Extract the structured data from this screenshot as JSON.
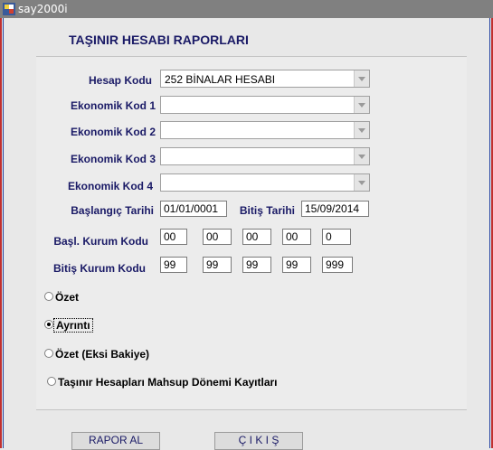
{
  "window": {
    "title": "say2000i"
  },
  "form": {
    "heading": "TAŞINIR HESABI RAPORLARI",
    "hesap_kodu": {
      "label": "Hesap Kodu",
      "value": "252 BİNALAR HESABI"
    },
    "ekonomik_kod_1": {
      "label": "Ekonomik Kod 1",
      "value": ""
    },
    "ekonomik_kod_2": {
      "label": "Ekonomik Kod 2",
      "value": ""
    },
    "ekonomik_kod_3": {
      "label": "Ekonomik Kod 3",
      "value": ""
    },
    "ekonomik_kod_4": {
      "label": "Ekonomik Kod 4",
      "value": ""
    },
    "baslangic_tarihi": {
      "label": "Başlangıç Tarihi",
      "value": "01/01/0001"
    },
    "bitis_tarihi": {
      "label": "Bitiş Tarihi",
      "value": "15/09/2014"
    },
    "basl_kurum_kodu": {
      "label": "Başl. Kurum  Kodu",
      "values": [
        "00",
        "00",
        "00",
        "00",
        "0"
      ]
    },
    "bitis_kurum_kodu": {
      "label": "Bitiş Kurum  Kodu",
      "values": [
        "99",
        "99",
        "99",
        "99",
        "999"
      ]
    }
  },
  "report_type": {
    "options": [
      {
        "label": "Özet",
        "checked": false
      },
      {
        "label": "Ayrıntı",
        "checked": true
      },
      {
        "label": "Özet (Eksi Bakiye)",
        "checked": false
      },
      {
        "label": "Taşınır Hesapları Mahsup Dönemi Kayıtları",
        "checked": false
      }
    ]
  },
  "buttons": {
    "rapor_al": "RAPOR AL",
    "cikis": "Ç I K I Ş"
  },
  "colors": {
    "label_text": "#1a1a66",
    "titlebar": "#808080",
    "frame_border": "#c03030"
  },
  "icons": {
    "app": "oracle-forms-app-icon",
    "combo_arrow": "chevron-down-icon"
  }
}
